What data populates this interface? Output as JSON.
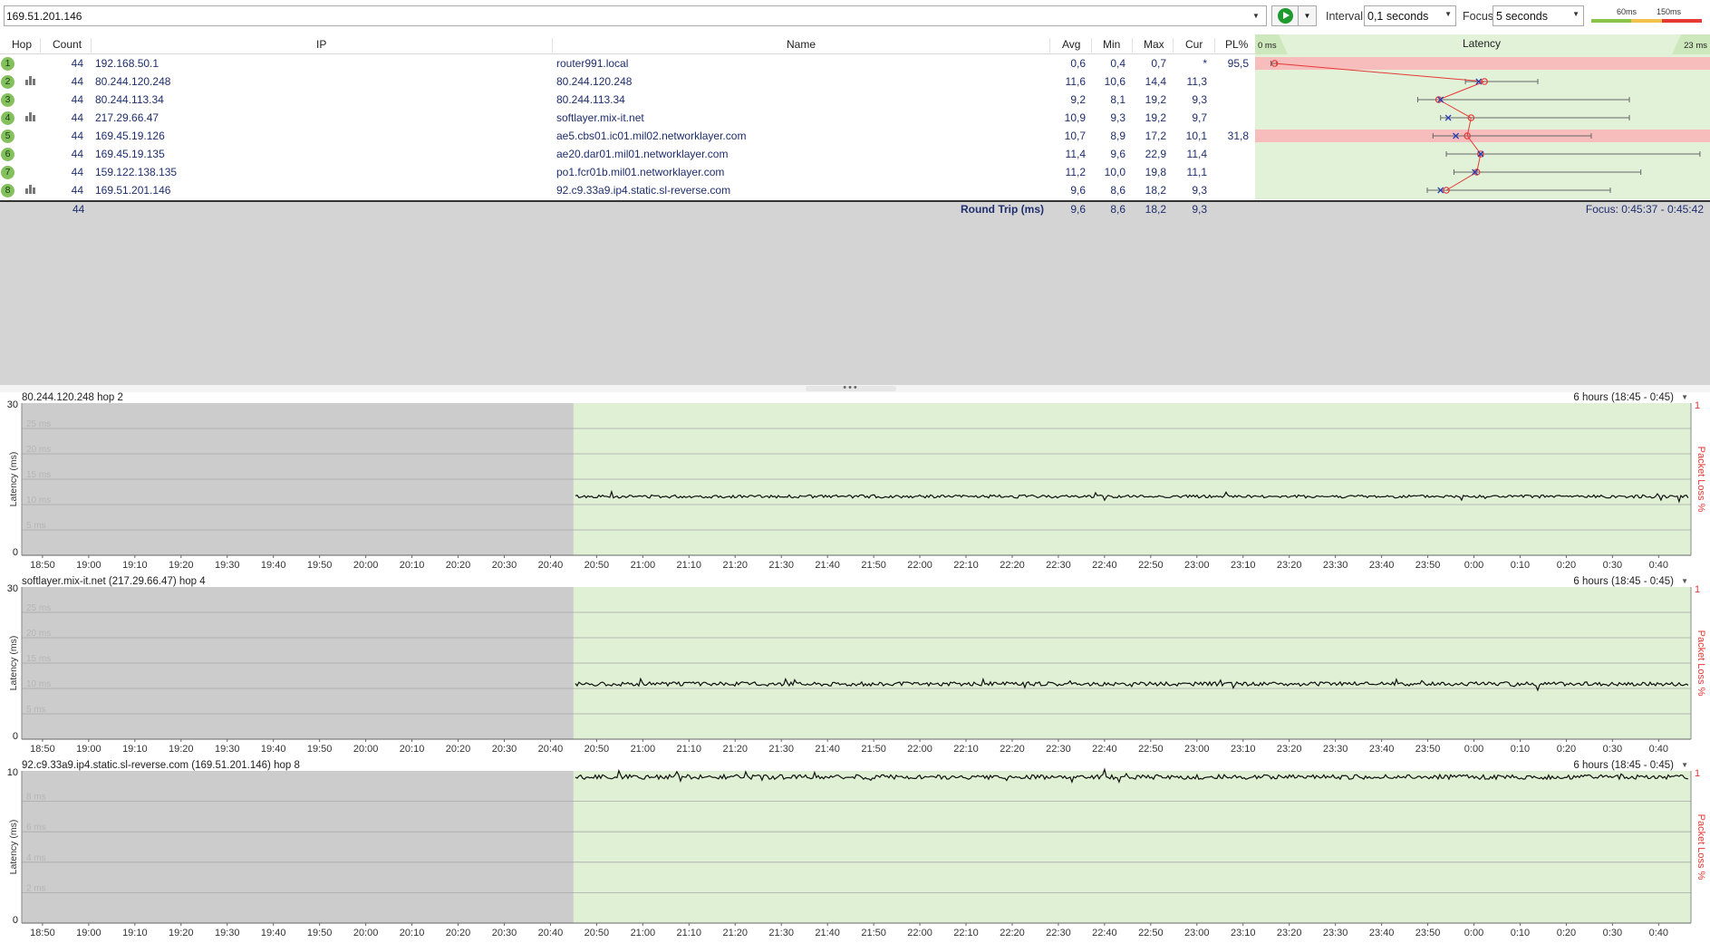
{
  "toolbar": {
    "target": "169.51.201.146",
    "interval_label": "Interval",
    "interval_value": "0,1 seconds",
    "focus_label": "Focus",
    "focus_value": "5 seconds",
    "legend_60": "60ms",
    "legend_150": "150ms",
    "legend_colors": [
      "#8bc34a",
      "#f2c14e",
      "#e53935"
    ]
  },
  "columns": {
    "hop": "Hop",
    "count": "Count",
    "ip": "IP",
    "name": "Name",
    "avg": "Avg",
    "min": "Min",
    "max": "Max",
    "cur": "Cur",
    "pl": "PL%",
    "latency": "Latency",
    "lat_min": "0 ms",
    "lat_max": "23 ms"
  },
  "hops": [
    {
      "hop": "1",
      "count": "44",
      "ip": "192.168.50.1",
      "name": "router991.local",
      "avg": "0,6",
      "min": "0,4",
      "max": "0,7",
      "cur": "*",
      "pl": "95,5",
      "graph": false,
      "loss": true,
      "avg_ms": 0.6,
      "min_ms": 0.4,
      "max_ms": 0.7,
      "cur_ms": null
    },
    {
      "hop": "2",
      "count": "44",
      "ip": "80.244.120.248",
      "name": "80.244.120.248",
      "avg": "11,6",
      "min": "10,6",
      "max": "14,4",
      "cur": "11,3",
      "pl": "",
      "graph": true,
      "loss": false,
      "avg_ms": 11.6,
      "min_ms": 10.6,
      "max_ms": 14.4,
      "cur_ms": 11.3
    },
    {
      "hop": "3",
      "count": "44",
      "ip": "80.244.113.34",
      "name": "80.244.113.34",
      "avg": "9,2",
      "min": "8,1",
      "max": "19,2",
      "cur": "9,3",
      "pl": "",
      "graph": false,
      "loss": false,
      "avg_ms": 9.2,
      "min_ms": 8.1,
      "max_ms": 19.2,
      "cur_ms": 9.3
    },
    {
      "hop": "4",
      "count": "44",
      "ip": "217.29.66.47",
      "name": "softlayer.mix-it.net",
      "avg": "10,9",
      "min": "9,3",
      "max": "19,2",
      "cur": "9,7",
      "pl": "",
      "graph": true,
      "loss": false,
      "avg_ms": 10.9,
      "min_ms": 9.3,
      "max_ms": 19.2,
      "cur_ms": 9.7
    },
    {
      "hop": "5",
      "count": "44",
      "ip": "169.45.19.126",
      "name": "ae5.cbs01.ic01.mil02.networklayer.com",
      "avg": "10,7",
      "min": "8,9",
      "max": "17,2",
      "cur": "10,1",
      "pl": "31,8",
      "graph": false,
      "loss": true,
      "avg_ms": 10.7,
      "min_ms": 8.9,
      "max_ms": 17.2,
      "cur_ms": 10.1
    },
    {
      "hop": "6",
      "count": "44",
      "ip": "169.45.19.135",
      "name": "ae20.dar01.mil01.networklayer.com",
      "avg": "11,4",
      "min": "9,6",
      "max": "22,9",
      "cur": "11,4",
      "pl": "",
      "graph": false,
      "loss": false,
      "avg_ms": 11.4,
      "min_ms": 9.6,
      "max_ms": 22.9,
      "cur_ms": 11.4
    },
    {
      "hop": "7",
      "count": "44",
      "ip": "159.122.138.135",
      "name": "po1.fcr01b.mil01.networklayer.com",
      "avg": "11,2",
      "min": "10,0",
      "max": "19,8",
      "cur": "11,1",
      "pl": "",
      "graph": false,
      "loss": false,
      "avg_ms": 11.2,
      "min_ms": 10.0,
      "max_ms": 19.8,
      "cur_ms": 11.1
    },
    {
      "hop": "8",
      "count": "44",
      "ip": "169.51.201.146",
      "name": "92.c9.33a9.ip4.static.sl-reverse.com",
      "avg": "9,6",
      "min": "8,6",
      "max": "18,2",
      "cur": "9,3",
      "pl": "",
      "graph": true,
      "loss": false,
      "avg_ms": 9.6,
      "min_ms": 8.6,
      "max_ms": 18.2,
      "cur_ms": 9.3
    }
  ],
  "summary": {
    "count": "44",
    "label": "Round Trip (ms)",
    "avg": "9,6",
    "min": "8,6",
    "max": "18,2",
    "cur": "9,3",
    "focus": "Focus: 0:45:37 - 0:45:42"
  },
  "time_labels": [
    "18:50",
    "19:00",
    "19:10",
    "19:20",
    "19:30",
    "19:40",
    "19:50",
    "20:00",
    "20:10",
    "20:20",
    "20:30",
    "20:40",
    "20:50",
    "21:00",
    "21:10",
    "21:20",
    "21:30",
    "21:40",
    "21:50",
    "22:00",
    "22:10",
    "22:20",
    "22:30",
    "22:40",
    "22:50",
    "23:00",
    "23:10",
    "23:20",
    "23:30",
    "23:40",
    "23:50",
    "0:00",
    "0:10",
    "0:20",
    "0:30",
    "0:40"
  ],
  "charts": [
    {
      "title": "80.244.120.248 hop 2",
      "range": "6 hours (18:45 - 0:45)",
      "ymax": "30",
      "ymin": "0",
      "max": 30,
      "level": 11.6,
      "jitter": 0.3,
      "ylabel": "Latency (ms)",
      "rlabel": "Packet Loss %",
      "rtop": "1",
      "gridlabels": [
        "25 ms",
        "20 ms",
        "15 ms",
        "10 ms",
        "5 ms"
      ]
    },
    {
      "title": "softlayer.mix-it.net (217.29.66.47) hop 4",
      "range": "6 hours (18:45 - 0:45)",
      "ymax": "30",
      "ymin": "0",
      "max": 30,
      "level": 10.9,
      "jitter": 0.4,
      "ylabel": "Latency (ms)",
      "rlabel": "Packet Loss %",
      "rtop": "1",
      "gridlabels": [
        "25 ms",
        "20 ms",
        "15 ms",
        "10 ms",
        "5 ms"
      ]
    },
    {
      "title": "92.c9.33a9.ip4.static.sl-reverse.com (169.51.201.146) hop 8",
      "range": "6 hours (18:45 - 0:45)",
      "ymax": "10",
      "ymin": "0",
      "max": 10,
      "level": 9.6,
      "jitter": 0.15,
      "ylabel": "Latency (ms)",
      "rlabel": "Packet Loss %",
      "rtop": "1",
      "gridlabels": [
        "8 ms",
        "6 ms",
        "4 ms",
        "2 ms"
      ]
    }
  ],
  "data_start_index": 11.5
}
